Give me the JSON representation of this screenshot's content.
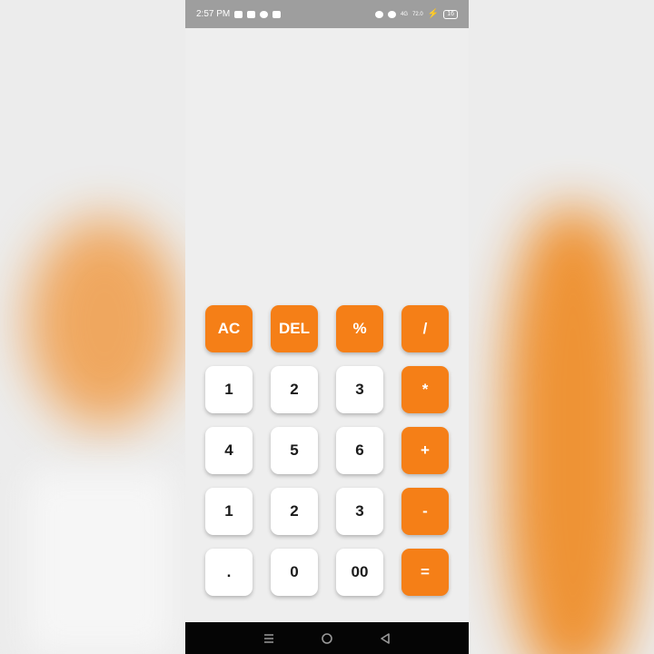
{
  "status_bar": {
    "time": "2:57 PM",
    "network_text": "4G",
    "speed_text": "72.0",
    "battery": "16"
  },
  "keypad": {
    "rows": [
      [
        {
          "label": "AC",
          "kind": "op"
        },
        {
          "label": "DEL",
          "kind": "op"
        },
        {
          "label": "%",
          "kind": "op"
        },
        {
          "label": "/",
          "kind": "op"
        }
      ],
      [
        {
          "label": "1",
          "kind": "num"
        },
        {
          "label": "2",
          "kind": "num"
        },
        {
          "label": "3",
          "kind": "num"
        },
        {
          "label": "*",
          "kind": "op"
        }
      ],
      [
        {
          "label": "4",
          "kind": "num"
        },
        {
          "label": "5",
          "kind": "num"
        },
        {
          "label": "6",
          "kind": "num"
        },
        {
          "label": "+",
          "kind": "op"
        }
      ],
      [
        {
          "label": "1",
          "kind": "num"
        },
        {
          "label": "2",
          "kind": "num"
        },
        {
          "label": "3",
          "kind": "num"
        },
        {
          "label": "-",
          "kind": "op"
        }
      ],
      [
        {
          "label": ".",
          "kind": "num"
        },
        {
          "label": "0",
          "kind": "num"
        },
        {
          "label": "00",
          "kind": "num"
        },
        {
          "label": "=",
          "kind": "op"
        }
      ]
    ]
  },
  "colors": {
    "accent": "#f57f17",
    "key_light": "#ffffff",
    "background": "#eeeeee"
  },
  "nav_icons": [
    "recents-icon",
    "home-icon",
    "back-icon"
  ]
}
